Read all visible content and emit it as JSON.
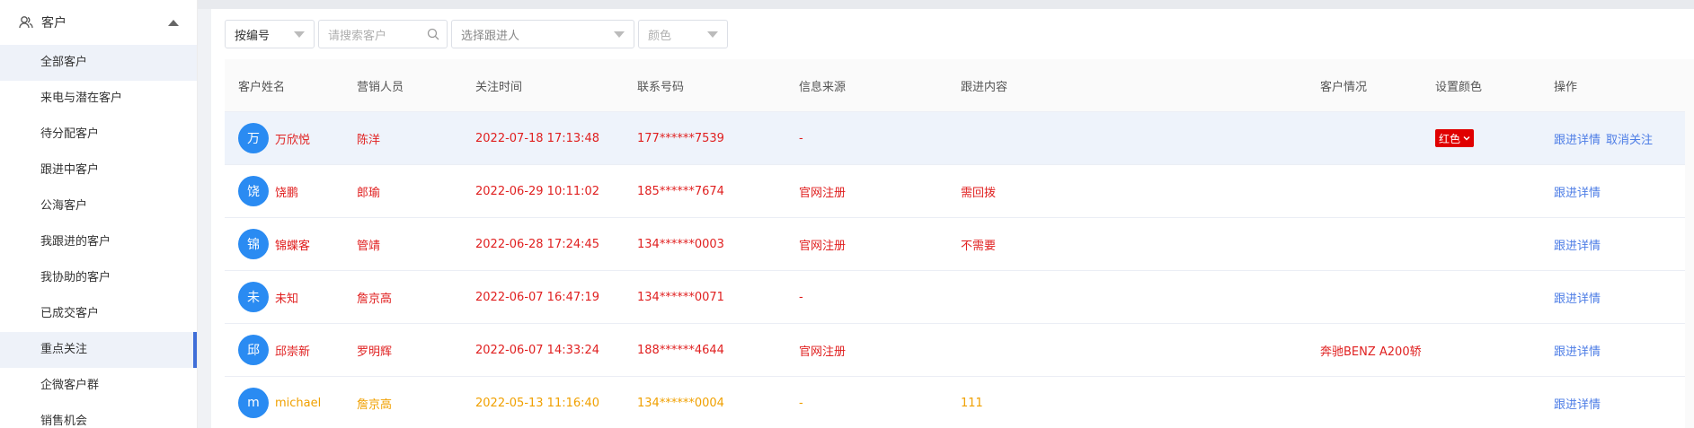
{
  "sidebar": {
    "header_label": "客户",
    "items": [
      {
        "label": "全部客户"
      },
      {
        "label": "来电与潜在客户"
      },
      {
        "label": "待分配客户"
      },
      {
        "label": "跟进中客户"
      },
      {
        "label": "公海客户"
      },
      {
        "label": "我跟进的客户"
      },
      {
        "label": "我协助的客户"
      },
      {
        "label": "已成交客户"
      },
      {
        "label": "重点关注"
      },
      {
        "label": "企微客户群"
      },
      {
        "label": "销售机会"
      }
    ]
  },
  "filters": {
    "sort_select": "按编号",
    "search_placeholder": "请搜索客户",
    "follower_placeholder": "选择跟进人",
    "color_placeholder": "颜色"
  },
  "table": {
    "headers": {
      "name": "客户姓名",
      "sales": "营销人员",
      "time": "关注时间",
      "phone": "联系号码",
      "source": "信息来源",
      "content": "跟进内容",
      "status": "客户情况",
      "color": "设置颜色",
      "ops": "操作"
    },
    "rows": [
      {
        "avatar": "万",
        "name": "万欣悦",
        "sales": "陈洋",
        "time": "2022-07-18 17:13:48",
        "phone": "177******7539",
        "source": "-",
        "content": "",
        "status": "",
        "color": "红色",
        "op1": "跟进详情",
        "op2": "取消关注"
      },
      {
        "avatar": "饶",
        "name": "饶鹏",
        "sales": "郎瑜",
        "time": "2022-06-29 10:11:02",
        "phone": "185******7674",
        "source": "官网注册",
        "content": "需回拨",
        "status": "",
        "color": "",
        "op1": "跟进详情",
        "op2": ""
      },
      {
        "avatar": "锦",
        "name": "锦蝶客",
        "sales": "管靖",
        "time": "2022-06-28 17:24:45",
        "phone": "134******0003",
        "source": "官网注册",
        "content": "不需要",
        "status": "",
        "color": "",
        "op1": "跟进详情",
        "op2": ""
      },
      {
        "avatar": "未",
        "name": "未知",
        "sales": "詹京高",
        "time": "2022-06-07 16:47:19",
        "phone": "134******0071",
        "source": "-",
        "content": "",
        "status": "",
        "color": "",
        "op1": "跟进详情",
        "op2": ""
      },
      {
        "avatar": "邱",
        "name": "邱崇新",
        "sales": "罗明辉",
        "time": "2022-06-07 14:33:24",
        "phone": "188******4644",
        "source": "官网注册",
        "content": "",
        "status": "奔驰BENZ A200轿",
        "color": "",
        "op1": "跟进详情",
        "op2": ""
      },
      {
        "avatar": "m",
        "name": "michael",
        "sales": "詹京高",
        "time": "2022-05-13 11:16:40",
        "phone": "134******0004",
        "source": "-",
        "content": "111",
        "status": "",
        "color": "",
        "op1": "跟进详情",
        "op2": ""
      }
    ]
  },
  "colors": {
    "red_text": "#e02020",
    "orange_text": "#f0a000",
    "link": "#4d7de6",
    "avatar": "#2a8bf2"
  }
}
